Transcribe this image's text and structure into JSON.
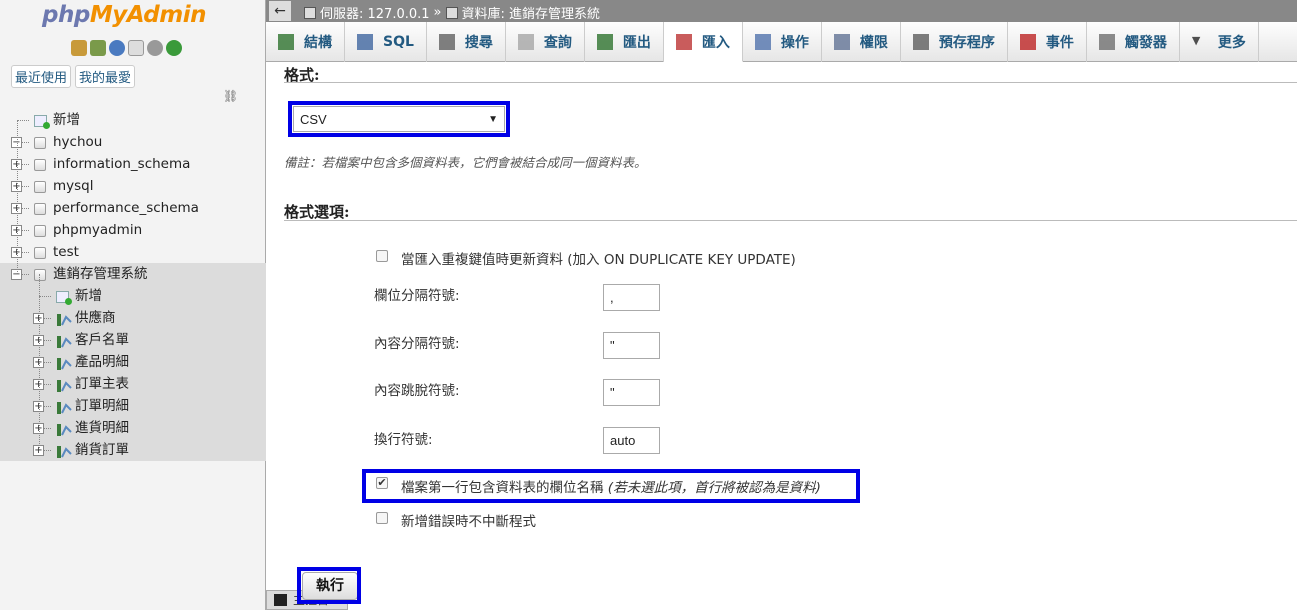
{
  "logo": {
    "php": "php",
    "myadmin": "MyAdmin"
  },
  "sidebar": {
    "tabs": [
      "最近使用",
      "我的最愛"
    ],
    "tree": [
      {
        "label": "新增",
        "kind": "new",
        "level": 0
      },
      {
        "label": "hychou",
        "kind": "db",
        "level": 0,
        "exp": "−"
      },
      {
        "label": "information_schema",
        "kind": "db",
        "level": 0,
        "exp": "+"
      },
      {
        "label": "mysql",
        "kind": "db",
        "level": 0,
        "exp": "+"
      },
      {
        "label": "performance_schema",
        "kind": "db",
        "level": 0,
        "exp": "+"
      },
      {
        "label": "phpmyadmin",
        "kind": "db",
        "level": 0,
        "exp": "+"
      },
      {
        "label": "test",
        "kind": "db",
        "level": 0,
        "exp": "+"
      },
      {
        "label": "進銷存管理系統",
        "kind": "db",
        "level": 0,
        "exp": "−",
        "selected": true
      },
      {
        "label": "新增",
        "kind": "new",
        "level": 1,
        "selected": true
      },
      {
        "label": "供應商",
        "kind": "table",
        "level": 1,
        "exp": "+",
        "selected": true
      },
      {
        "label": "客戶名單",
        "kind": "table",
        "level": 1,
        "exp": "+",
        "selected": true
      },
      {
        "label": "產品明細",
        "kind": "table",
        "level": 1,
        "exp": "+",
        "selected": true
      },
      {
        "label": "訂單主表",
        "kind": "table",
        "level": 1,
        "exp": "+",
        "selected": true
      },
      {
        "label": "訂單明細",
        "kind": "table",
        "level": 1,
        "exp": "+",
        "selected": true
      },
      {
        "label": "進貨明細",
        "kind": "table",
        "level": 1,
        "exp": "+",
        "selected": true
      },
      {
        "label": "銷貨訂單",
        "kind": "table",
        "level": 1,
        "exp": "+",
        "selected": true
      }
    ]
  },
  "topbar": {
    "back": "←",
    "server": "伺服器: 127.0.0.1",
    "sep": "»",
    "database": "資料庫: 進銷存管理系統"
  },
  "tabs": [
    {
      "label": "結構",
      "icon": "structure-icon",
      "color": "#3a7a3a"
    },
    {
      "label": "SQL",
      "icon": "sql-icon",
      "color": "#4a6fa5"
    },
    {
      "label": "搜尋",
      "icon": "search-icon",
      "color": "#6a6a6a"
    },
    {
      "label": "查詢",
      "icon": "query-icon",
      "color": "#aaaaaa"
    },
    {
      "label": "匯出",
      "icon": "export-icon",
      "color": "#3a7a3a"
    },
    {
      "label": "匯入",
      "icon": "import-icon",
      "color": "#c04040",
      "active": true
    },
    {
      "label": "操作",
      "icon": "wrench-icon",
      "color": "#5a7ab0"
    },
    {
      "label": "權限",
      "icon": "privileges-icon",
      "color": "#6a7a9a"
    },
    {
      "label": "預存程序",
      "icon": "routines-icon",
      "color": "#666666"
    },
    {
      "label": "事件",
      "icon": "clock-icon",
      "color": "#c03030"
    },
    {
      "label": "觸發器",
      "icon": "trigger-icon",
      "color": "#777777"
    },
    {
      "label": "更多",
      "icon": "more-icon",
      "color": "#333333"
    }
  ],
  "main": {
    "format_title": "格式:",
    "format_value": "CSV",
    "format_note": "備註：若檔案中包含多個資料表，它們會被結合成同一個資料表。",
    "options_title": "格式選項:",
    "option_duplicate": "當匯入重複鍵值時更新資料 (加入 ON DUPLICATE KEY UPDATE)",
    "field_sep_label": "欄位分隔符號:",
    "field_sep_value": ",",
    "enclose_label": "內容分隔符號:",
    "enclose_value": "\"",
    "escape_label": "內容跳脫符號:",
    "escape_value": "\"",
    "newline_label": "換行符號:",
    "newline_value": "auto",
    "first_row_label": "檔案第一行包含資料表的欄位名稱",
    "first_row_hint": "(若未選此項，首行將被認為是資料)",
    "no_abort_label": "新增錯誤時不中斷程式",
    "go_button": "執行",
    "console": "主控台"
  }
}
